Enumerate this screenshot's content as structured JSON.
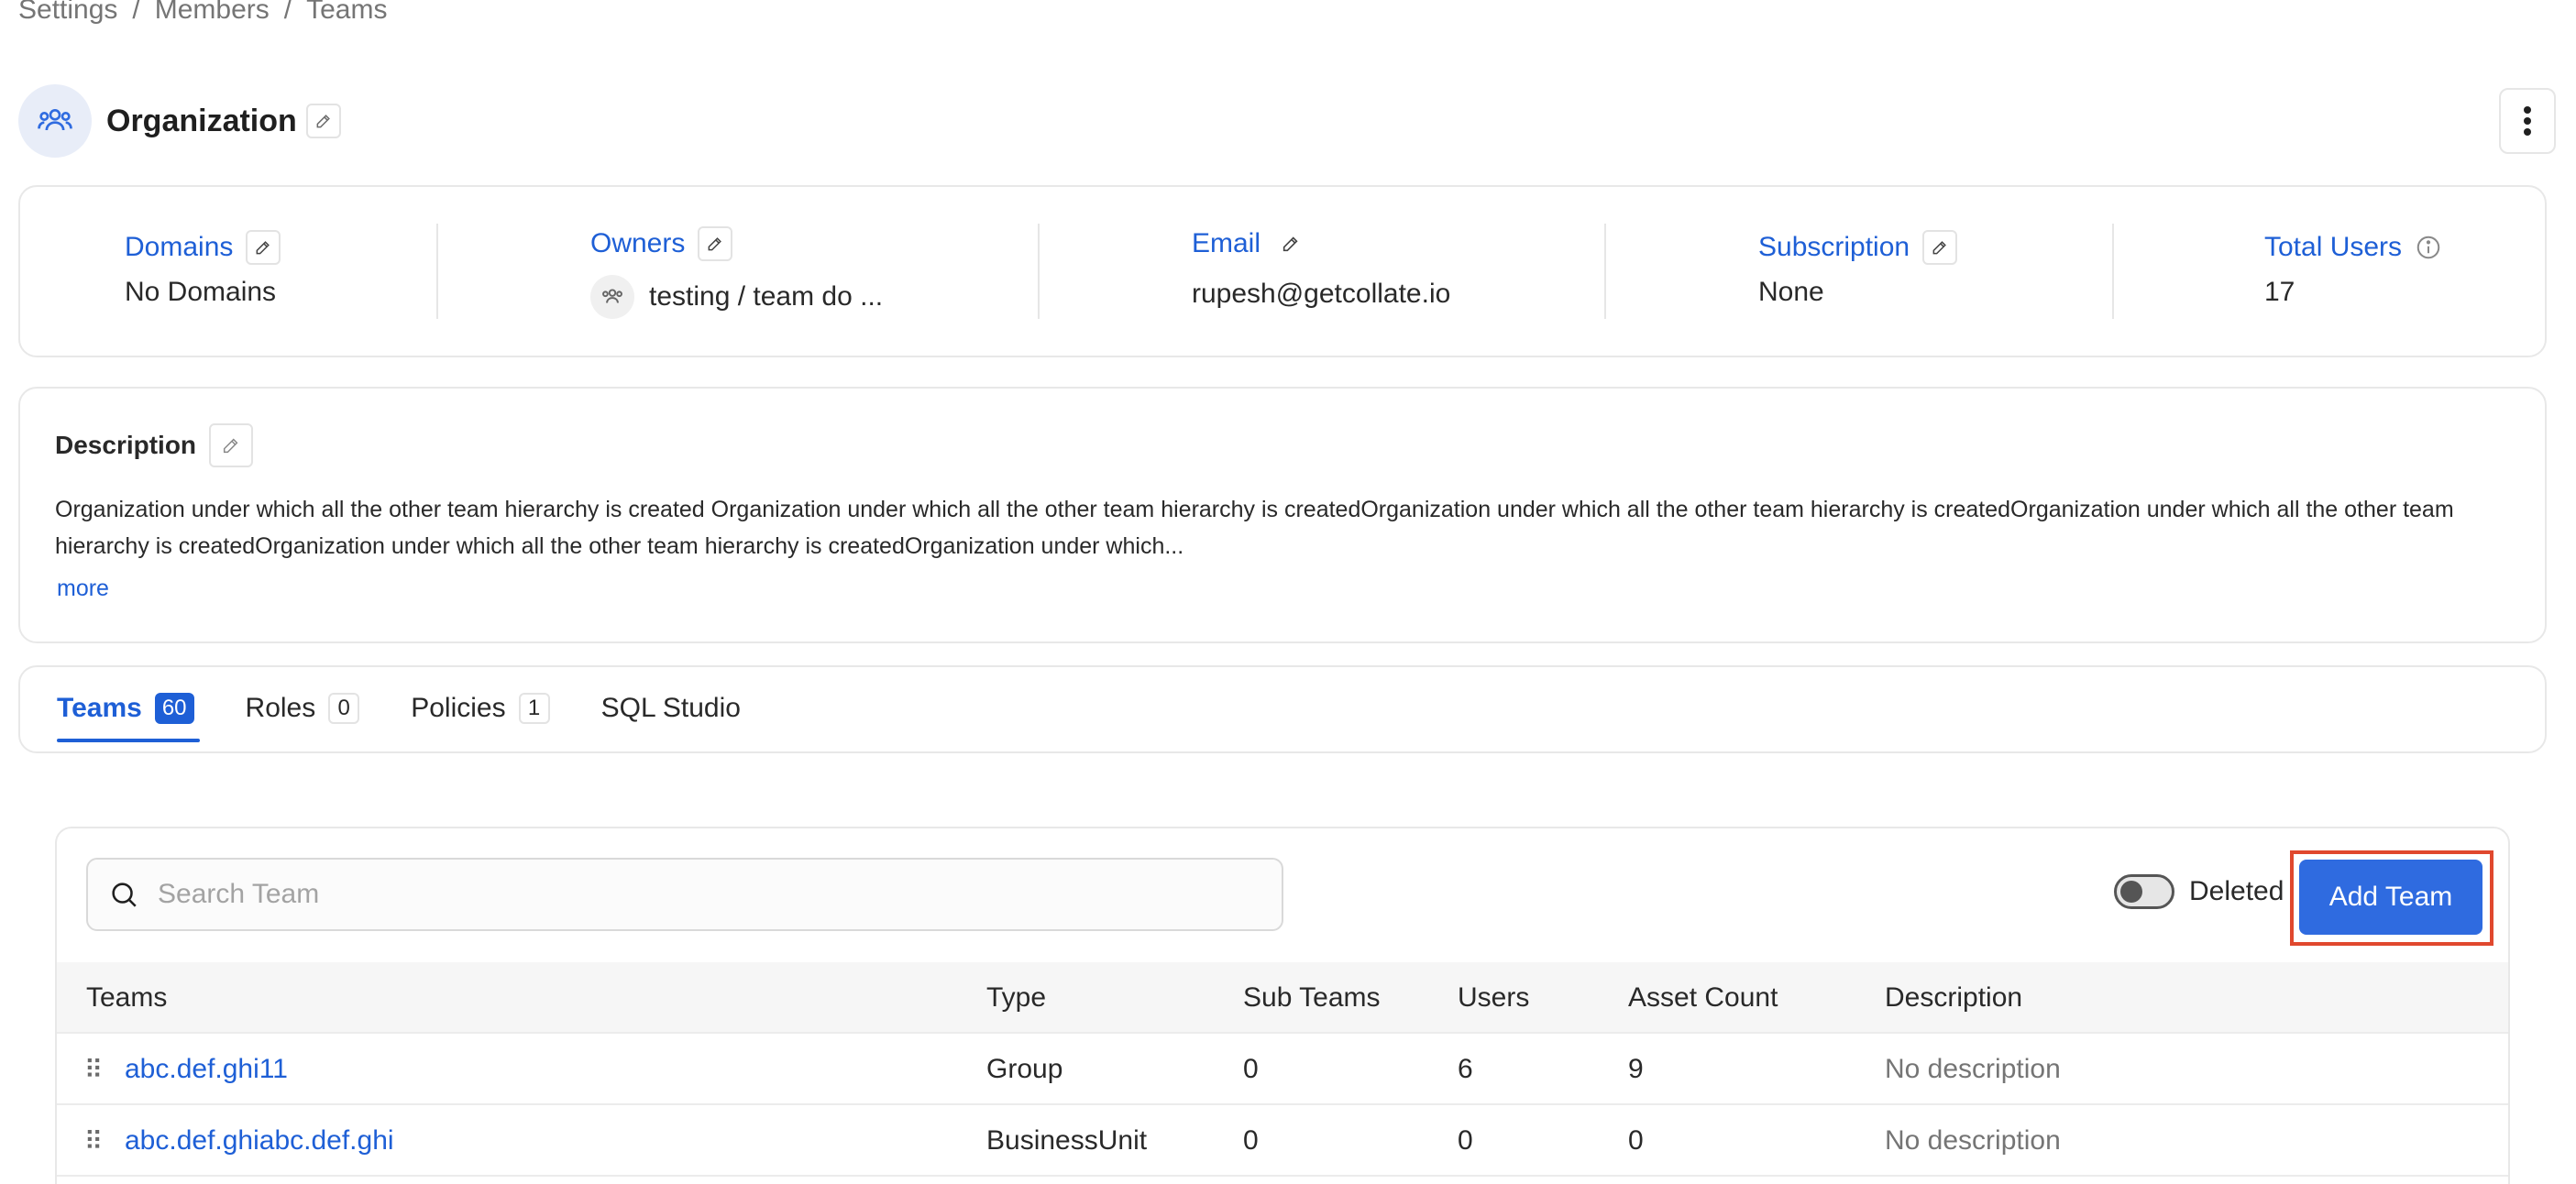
{
  "breadcrumb": [
    "Settings",
    "Members",
    "Teams"
  ],
  "breadcrumb_separator": "/",
  "org": {
    "title": "Organization"
  },
  "info": {
    "domains": {
      "label": "Domains",
      "value": "No Domains"
    },
    "owners": {
      "label": "Owners",
      "value": "testing / team do ..."
    },
    "email": {
      "label": "Email",
      "value": "rupesh@getcollate.io"
    },
    "subscription": {
      "label": "Subscription",
      "value": "None"
    },
    "total_users": {
      "label": "Total Users",
      "value": "17"
    }
  },
  "description": {
    "title": "Description",
    "text": "Organization under which all the other team hierarchy is created Organization under which all the other team hierarchy is createdOrganization under which all the other team hierarchy is createdOrganization under which all the other team hierarchy is createdOrganization under which all the other team hierarchy is createdOrganization under which...",
    "more": "more"
  },
  "tabs": [
    {
      "label": "Teams",
      "count": "60",
      "active": true
    },
    {
      "label": "Roles",
      "count": "0",
      "active": false
    },
    {
      "label": "Policies",
      "count": "1",
      "active": false
    },
    {
      "label": "SQL Studio",
      "count": null,
      "active": false
    }
  ],
  "search": {
    "placeholder": "Search Team"
  },
  "toggle": {
    "label": "Deleted",
    "on": false
  },
  "add_team_label": "Add Team",
  "table": {
    "headers": {
      "teams": "Teams",
      "type": "Type",
      "sub_teams": "Sub Teams",
      "users": "Users",
      "asset_count": "Asset Count",
      "description": "Description"
    },
    "rows": [
      {
        "name": "abc.def.ghi11",
        "type": "Group",
        "sub_teams": "0",
        "users": "6",
        "asset_count": "9",
        "description": "No description"
      },
      {
        "name": "abc.def.ghiabc.def.ghi",
        "type": "BusinessUnit",
        "sub_teams": "0",
        "users": "0",
        "asset_count": "0",
        "description": "No description"
      }
    ]
  },
  "colors": {
    "accent": "#1e5fd6",
    "button": "#2f6be0",
    "highlight": "#e0482e"
  },
  "icons": [
    "team-icon",
    "edit-icon",
    "kebab-icon",
    "info-icon",
    "search-icon",
    "drag-handle-icon"
  ]
}
